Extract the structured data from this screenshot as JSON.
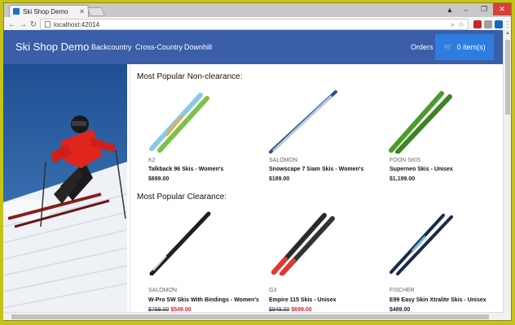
{
  "browser": {
    "tab_title": "Ski Shop Demo",
    "address": "localhost:42014"
  },
  "navbar": {
    "brand": "Ski Shop Demo",
    "links": [
      "Backcountry",
      "Cross-Country",
      "Downhill"
    ],
    "orders": "Orders",
    "cart_label": "0 item(s)"
  },
  "sections": [
    {
      "title": "Most Popular Non-clearance:",
      "products": [
        {
          "brand": "K2",
          "name": "Talkback 96 Skis - Women's",
          "price": "$699.00",
          "old_price": "",
          "sale_price": ""
        },
        {
          "brand": "SALOMON",
          "name": "Snowscape 7 Siam Skis - Women's",
          "price": "$189.00",
          "old_price": "",
          "sale_price": ""
        },
        {
          "brand": "FOON SKIS",
          "name": "Superneo Skis - Unisex",
          "price": "$1,199.00",
          "old_price": "",
          "sale_price": ""
        }
      ]
    },
    {
      "title": "Most Popular Clearance:",
      "products": [
        {
          "brand": "SALOMON",
          "name": "W-Pro SW Skis With Bindings - Women's",
          "price": "",
          "old_price": "$799.00",
          "sale_price": "$549.00"
        },
        {
          "brand": "G3",
          "name": "Empire 115 Skis - Unisex",
          "price": "",
          "old_price": "$949.00",
          "sale_price": "$699.00"
        },
        {
          "brand": "FISCHER",
          "name": "E99 Easy Skin Xtralite Skis - Unisex",
          "price": "$489.00",
          "old_price": "",
          "sale_price": ""
        }
      ]
    }
  ],
  "icons": {
    "cart": "shopping-cart-icon",
    "back": "back-arrow-icon",
    "forward": "forward-arrow-icon",
    "reload": "reload-icon"
  },
  "colors": {
    "navbar": "#3a5ea8",
    "cart_button": "#2d7de0",
    "sale_price": "#d0282c"
  }
}
